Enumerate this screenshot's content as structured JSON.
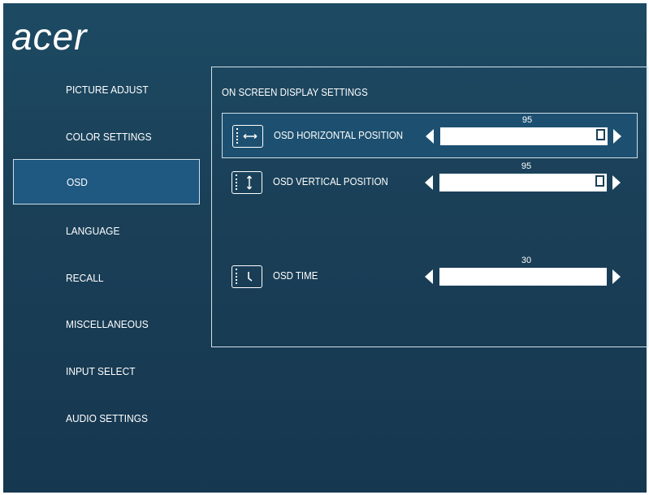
{
  "brand": {
    "logo_text": "acer"
  },
  "menu": {
    "items": [
      {
        "label": "PICTURE ADJUST"
      },
      {
        "label": "COLOR SETTINGS"
      },
      {
        "label": "OSD"
      },
      {
        "label": "LANGUAGE"
      },
      {
        "label": "RECALL"
      },
      {
        "label": "MISCELLANEOUS"
      },
      {
        "label": "INPUT SELECT"
      },
      {
        "label": "AUDIO SETTINGS"
      }
    ],
    "selected": "OSD"
  },
  "panel": {
    "title": "ON SCREEN DISPLAY SETTINGS",
    "settings": [
      {
        "label": "OSD HORIZONTAL POSITION",
        "value": "95",
        "level_percent": 95,
        "icon": "horizontal-arrows-icon"
      },
      {
        "label": "OSD VERTICAL POSITION",
        "value": "95",
        "level_percent": 95,
        "icon": "vertical-arrows-icon"
      },
      {
        "label": "OSD TIME",
        "value": "30",
        "level_percent": 100,
        "icon": "clock-icon"
      }
    ]
  },
  "colors": {
    "background": "#1a3f57",
    "selected": "#1f5880",
    "border": "#cfe0ea"
  }
}
